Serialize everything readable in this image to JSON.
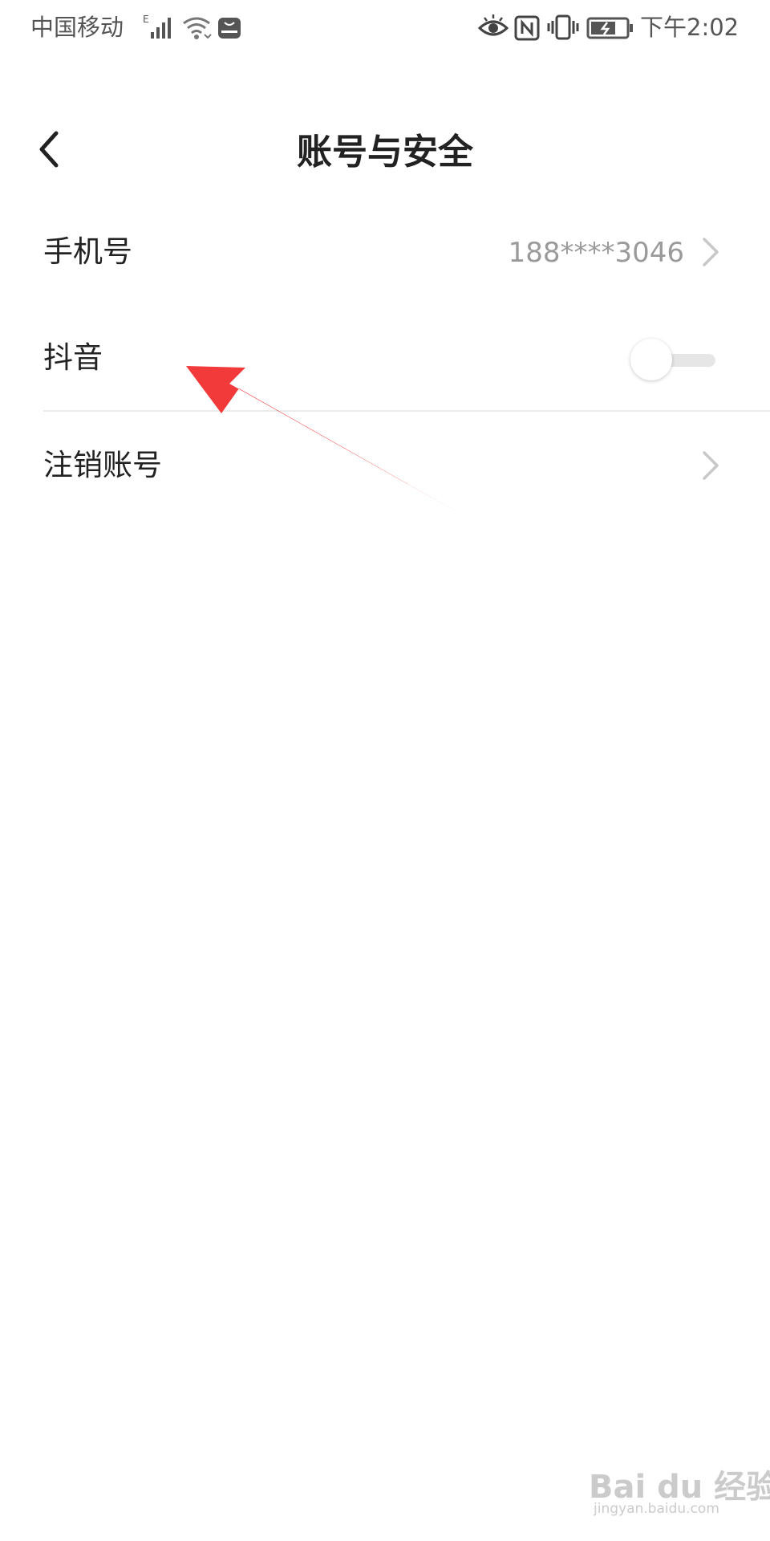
{
  "status_bar": {
    "carrier": "中国移动",
    "signal_type": "E",
    "time": "下午2:02",
    "icons": [
      "signal-icon",
      "wifi-icon",
      "huawei-app-icon",
      "eye-comfort-icon",
      "nfc-icon",
      "vibrate-icon",
      "battery-charging-icon"
    ]
  },
  "header": {
    "title": "账号与安全",
    "back_icon": "chevron-left-icon"
  },
  "settings": {
    "phone": {
      "label": "手机号",
      "value": "188****3046"
    },
    "douyin": {
      "label": "抖音",
      "toggle_on": false
    },
    "cancel_account": {
      "label": "注销账号"
    }
  },
  "annotation": {
    "color": "#f23a3a"
  },
  "watermark": {
    "text": "Bai du 经验",
    "url": "jingyan.baidu.com"
  }
}
